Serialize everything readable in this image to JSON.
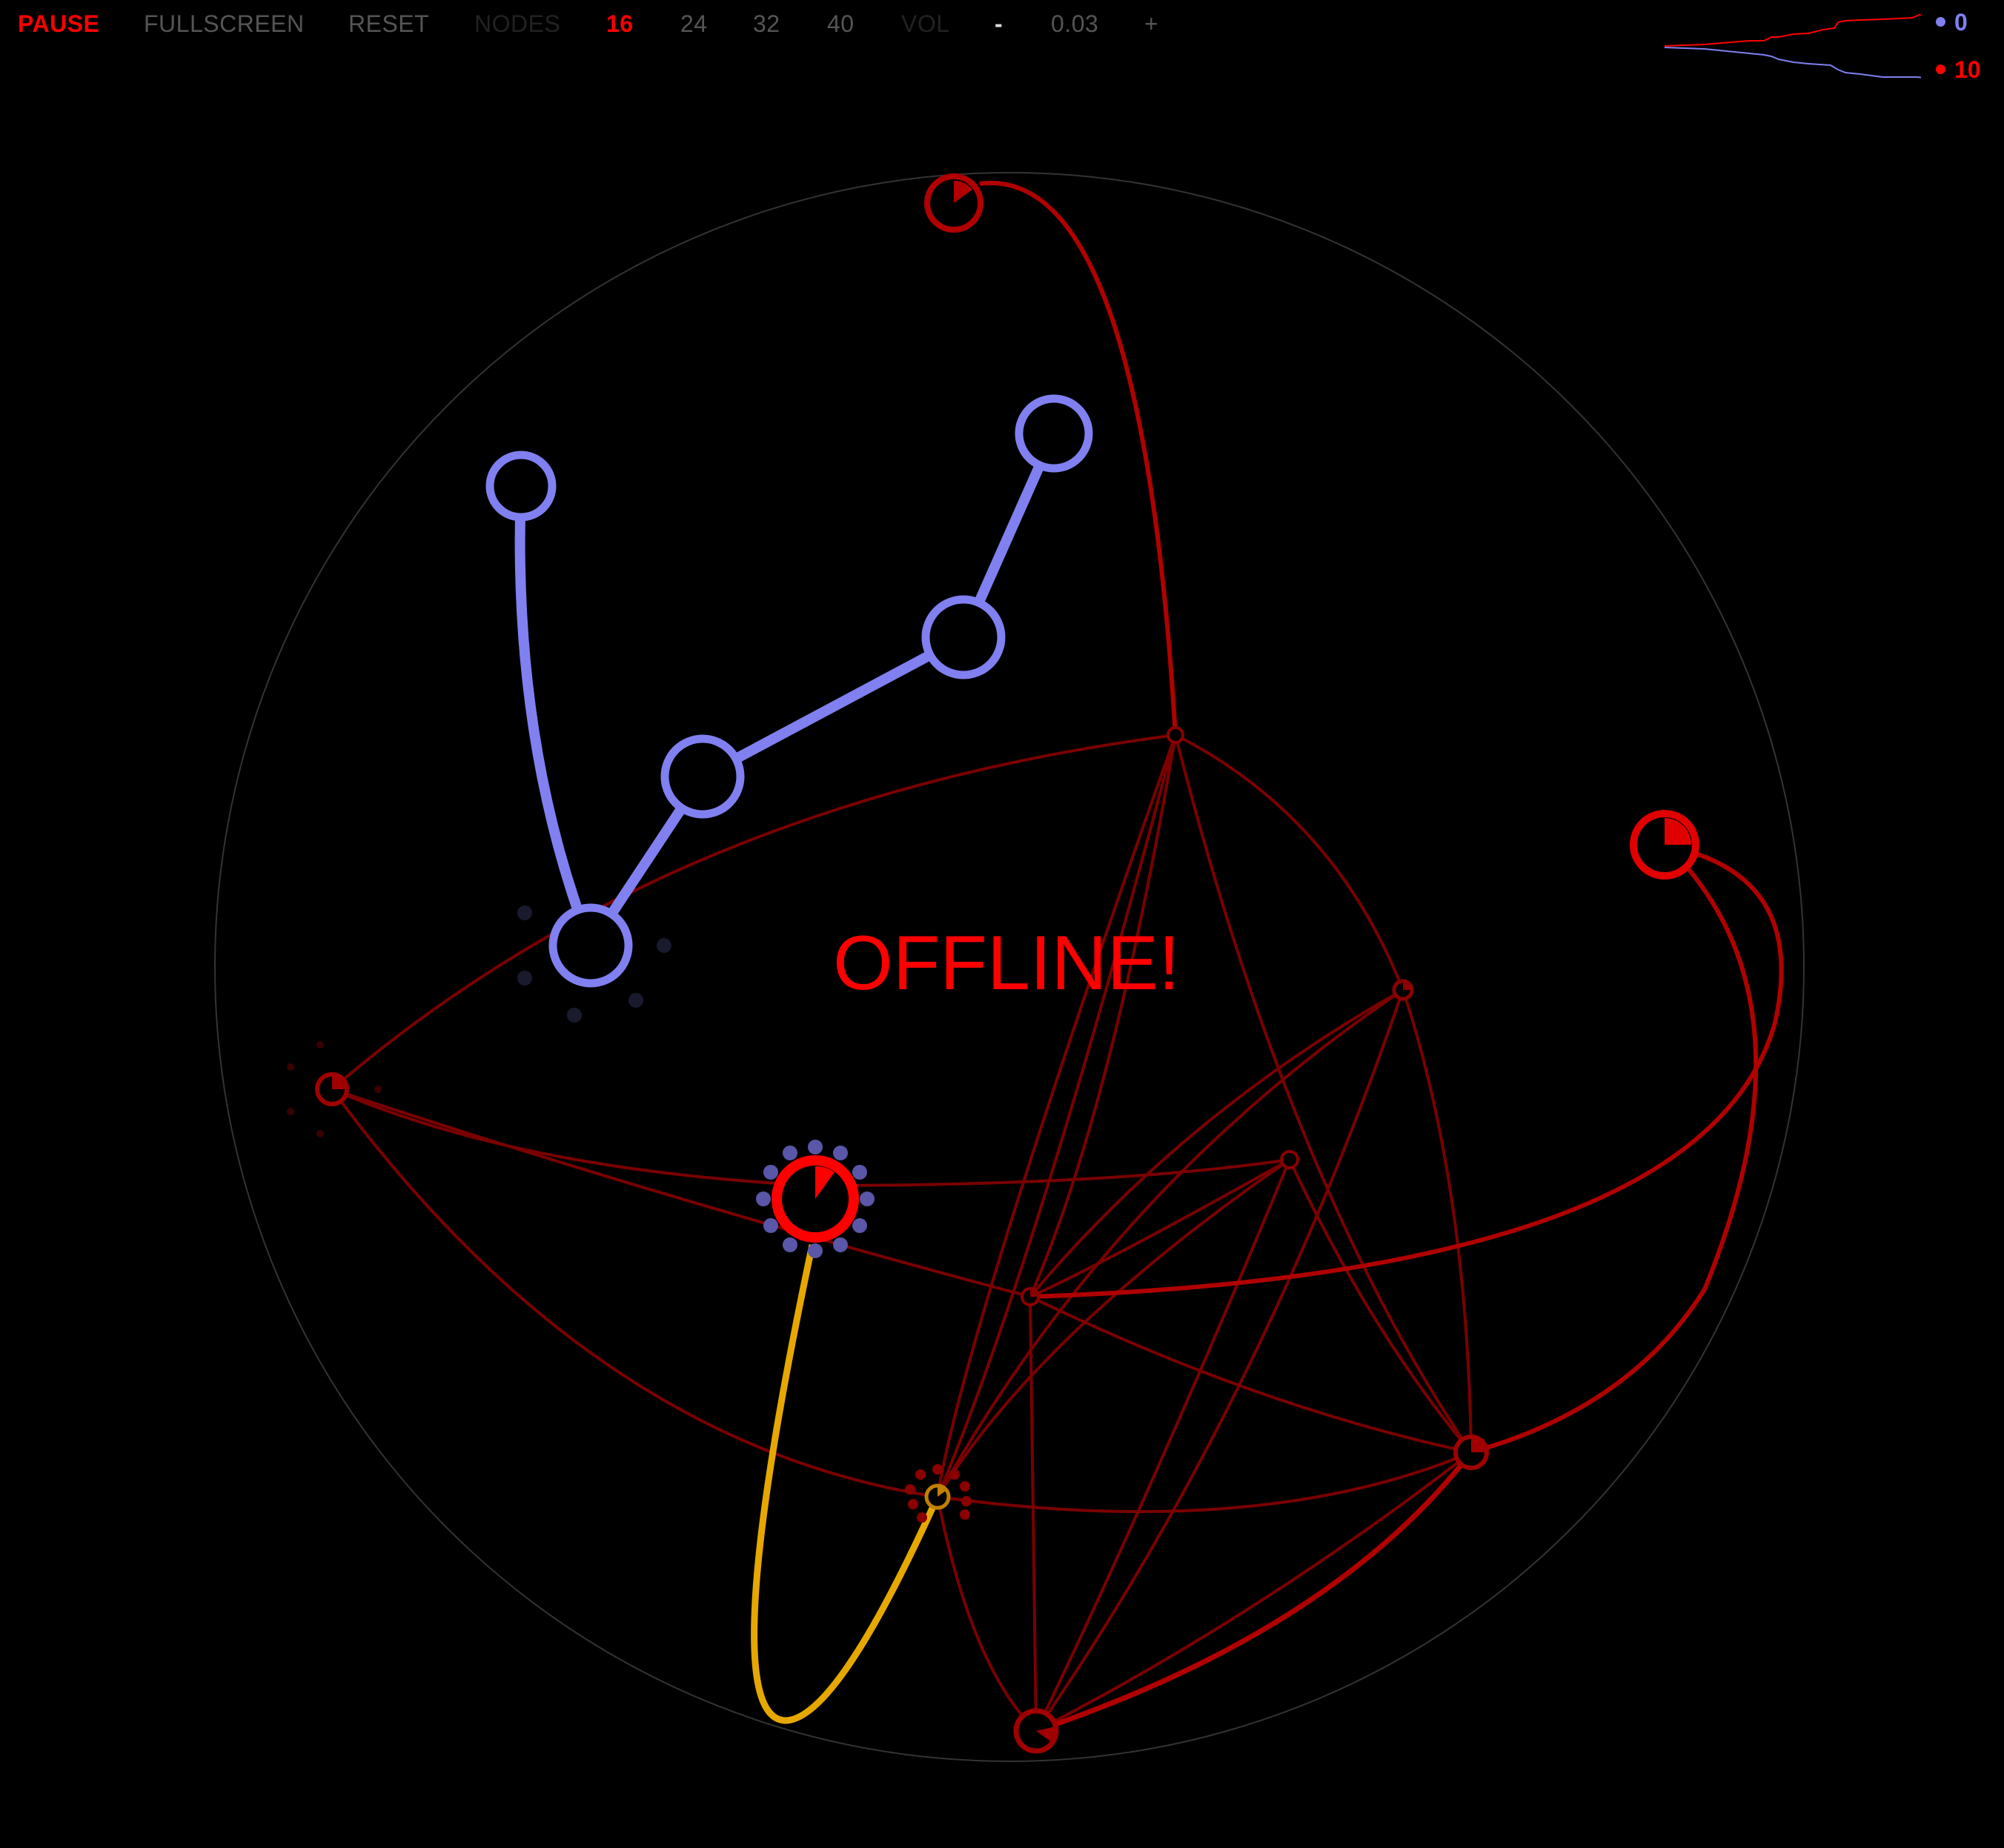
{
  "menu": {
    "pause": "PAUSE",
    "fullscreen": "FULLSCREEN",
    "reset": "RESET",
    "nodes_label": "NODES",
    "node_options": [
      "16",
      "24",
      "32",
      "40"
    ],
    "selected_nodes": "16",
    "vol_label": "VOL",
    "vol_down": "-",
    "vol_value": "0.03",
    "vol_up": "+"
  },
  "scores": {
    "blue": "0",
    "red": "10"
  },
  "status": "OFFLINE!",
  "colors": {
    "background": "#000000",
    "blue_player": "#8080f0",
    "red_player": "#ff0000",
    "red_dark": "#8b0000",
    "link_highlight": "#e6a800",
    "boundary": "#333333"
  },
  "icons": {
    "blue_marker": "blue-dot-icon",
    "red_marker": "red-dot-icon"
  }
}
